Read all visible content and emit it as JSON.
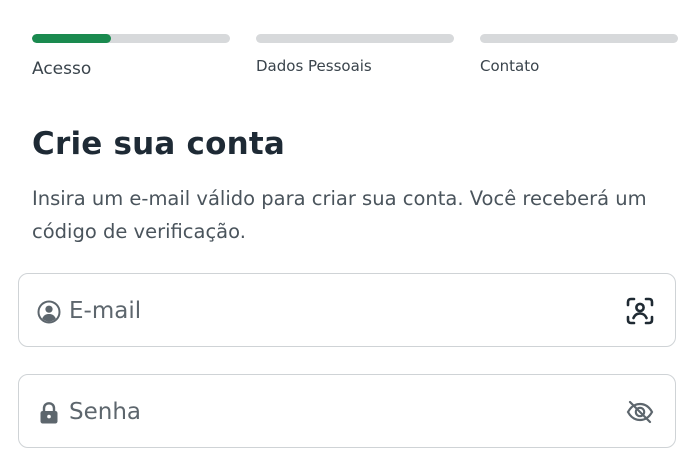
{
  "progress": {
    "steps": [
      {
        "label": "Acesso",
        "progress": 0.4,
        "active": true
      },
      {
        "label": "Dados Pessoais",
        "progress": 0,
        "active": false
      },
      {
        "label": "Contato",
        "progress": 0,
        "active": false
      }
    ]
  },
  "header": {
    "title": "Crie sua conta",
    "description": "Insira um e-mail válido para criar sua conta. Você receberá um código de verificação."
  },
  "form": {
    "email": {
      "placeholder": "E-mail",
      "value": "",
      "lead_icon": "user-circle-icon",
      "trail_icon": "face-scan-icon"
    },
    "password": {
      "placeholder": "Senha",
      "value": "",
      "lead_icon": "lock-icon",
      "trail_icon": "eye-off-icon"
    }
  },
  "colors": {
    "accent": "#1a8a4f",
    "track": "#d7d9db",
    "text": "#1e2a35"
  }
}
